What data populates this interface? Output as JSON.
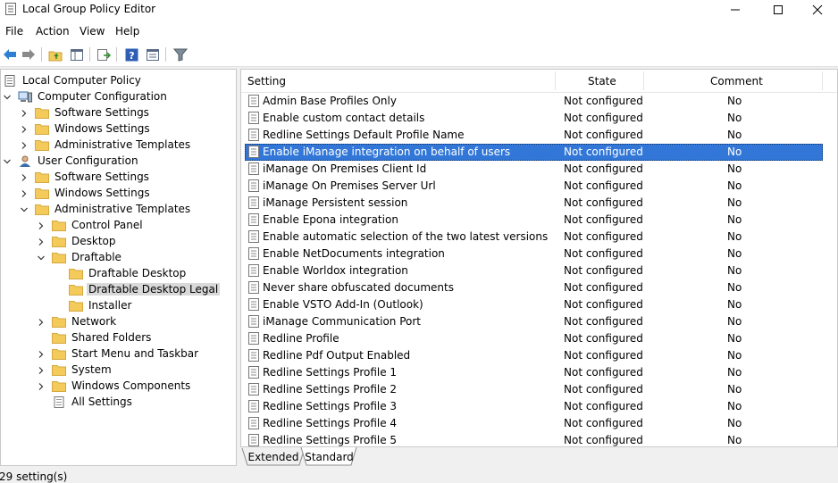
{
  "window": {
    "title": "Local Group Policy Editor"
  },
  "menu": [
    "File",
    "Action",
    "View",
    "Help"
  ],
  "toolbar": [
    "back-arrow-icon",
    "forward-arrow-icon",
    "up-folder-icon",
    "show-hide-tree-icon",
    "export-list-icon",
    "help-icon",
    "properties-icon",
    "filter-icon"
  ],
  "tree": [
    {
      "label": "Local Computer Policy",
      "icon": "policy-icon",
      "expander": "none",
      "level": 0
    },
    {
      "label": "Computer Configuration",
      "icon": "computer-icon",
      "expander": "expanded",
      "level": 1
    },
    {
      "label": "Software Settings",
      "icon": "folder-icon",
      "expander": "collapsed",
      "level": 2
    },
    {
      "label": "Windows Settings",
      "icon": "folder-icon",
      "expander": "collapsed",
      "level": 2
    },
    {
      "label": "Administrative Templates",
      "icon": "folder-icon",
      "expander": "collapsed",
      "level": 2
    },
    {
      "label": "User Configuration",
      "icon": "user-icon",
      "expander": "expanded",
      "level": 1
    },
    {
      "label": "Software Settings",
      "icon": "folder-icon",
      "expander": "collapsed",
      "level": 2
    },
    {
      "label": "Windows Settings",
      "icon": "folder-icon",
      "expander": "collapsed",
      "level": 2
    },
    {
      "label": "Administrative Templates",
      "icon": "folder-icon",
      "expander": "expanded",
      "level": 2
    },
    {
      "label": "Control Panel",
      "icon": "folder-icon",
      "expander": "collapsed",
      "level": 3
    },
    {
      "label": "Desktop",
      "icon": "folder-icon",
      "expander": "collapsed",
      "level": 3
    },
    {
      "label": "Draftable",
      "icon": "folder-icon",
      "expander": "expanded",
      "level": 3
    },
    {
      "label": "Draftable Desktop",
      "icon": "folder-icon",
      "expander": "none",
      "level": 4
    },
    {
      "label": "Draftable Desktop Legal",
      "icon": "folder-open-icon",
      "expander": "none",
      "level": 4,
      "selected": true
    },
    {
      "label": "Installer",
      "icon": "folder-icon",
      "expander": "none",
      "level": 4
    },
    {
      "label": "Network",
      "icon": "folder-icon",
      "expander": "collapsed",
      "level": 3
    },
    {
      "label": "Shared Folders",
      "icon": "folder-icon",
      "expander": "none",
      "level": 3
    },
    {
      "label": "Start Menu and Taskbar",
      "icon": "folder-icon",
      "expander": "collapsed",
      "level": 3
    },
    {
      "label": "System",
      "icon": "folder-icon",
      "expander": "collapsed",
      "level": 3
    },
    {
      "label": "Windows Components",
      "icon": "folder-icon",
      "expander": "collapsed",
      "level": 3
    },
    {
      "label": "All Settings",
      "icon": "all-settings-icon",
      "expander": "none",
      "level": 3
    }
  ],
  "columns": {
    "setting": "Setting",
    "state": "State",
    "comment": "Comment"
  },
  "settings": [
    {
      "name": "Admin Base Profiles Only",
      "state": "Not configured",
      "comment": "No"
    },
    {
      "name": "Enable custom contact details",
      "state": "Not configured",
      "comment": "No"
    },
    {
      "name": "Redline Settings Default Profile Name",
      "state": "Not configured",
      "comment": "No"
    },
    {
      "name": "Enable iManage integration on behalf of users",
      "state": "Not configured",
      "comment": "No",
      "selected": true
    },
    {
      "name": "iManage On Premises Client Id",
      "state": "Not configured",
      "comment": "No"
    },
    {
      "name": "iManage On Premises Server Url",
      "state": "Not configured",
      "comment": "No"
    },
    {
      "name": "iManage Persistent session",
      "state": "Not configured",
      "comment": "No"
    },
    {
      "name": "Enable Epona integration",
      "state": "Not configured",
      "comment": "No"
    },
    {
      "name": "Enable automatic selection of the two latest versions",
      "state": "Not configured",
      "comment": "No"
    },
    {
      "name": "Enable NetDocuments integration",
      "state": "Not configured",
      "comment": "No"
    },
    {
      "name": "Enable Worldox integration",
      "state": "Not configured",
      "comment": "No"
    },
    {
      "name": "Never share obfuscated documents",
      "state": "Not configured",
      "comment": "No"
    },
    {
      "name": "Enable VSTO Add-In (Outlook)",
      "state": "Not configured",
      "comment": "No"
    },
    {
      "name": "iManage Communication Port",
      "state": "Not configured",
      "comment": "No"
    },
    {
      "name": "Redline Profile",
      "state": "Not configured",
      "comment": "No"
    },
    {
      "name": "Redline Pdf Output Enabled",
      "state": "Not configured",
      "comment": "No"
    },
    {
      "name": "Redline Settings Profile 1",
      "state": "Not configured",
      "comment": "No"
    },
    {
      "name": "Redline Settings Profile 2",
      "state": "Not configured",
      "comment": "No"
    },
    {
      "name": "Redline Settings Profile 3",
      "state": "Not configured",
      "comment": "No"
    },
    {
      "name": "Redline Settings Profile 4",
      "state": "Not configured",
      "comment": "No"
    },
    {
      "name": "Redline Settings Profile 5",
      "state": "Not configured",
      "comment": "No"
    }
  ],
  "tabs": [
    {
      "label": "Extended",
      "active": false
    },
    {
      "label": "Standard",
      "active": true
    }
  ],
  "status": "29 setting(s)",
  "colors": {
    "selection": "#3277d7",
    "folder": "#f4cb5a"
  }
}
